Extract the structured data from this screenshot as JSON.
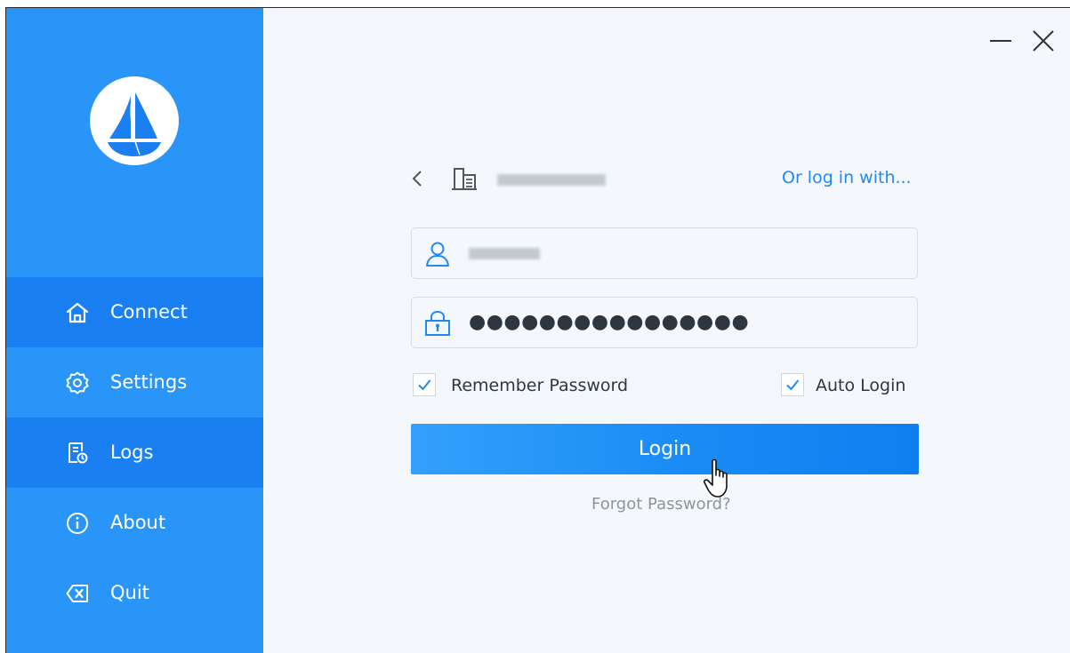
{
  "window": {
    "minimize_icon": "minimize-icon",
    "close_icon": "close-icon"
  },
  "sidebar": {
    "logo_icon": "sailboat-logo",
    "items": [
      {
        "label": "Connect",
        "icon": "home-icon",
        "active": true
      },
      {
        "label": "Settings",
        "icon": "gear-icon",
        "active": false
      },
      {
        "label": "Logs",
        "icon": "log-document-icon",
        "active": true
      },
      {
        "label": "About",
        "icon": "info-icon",
        "active": false
      },
      {
        "label": "Quit",
        "icon": "backspace-icon",
        "active": false
      }
    ]
  },
  "login": {
    "back_icon": "chevron-left-icon",
    "org_icon": "building-icon",
    "alt_login_link": "Or log in with...",
    "username_icon": "user-icon",
    "password_icon": "lock-icon",
    "password_masked": "●●●●●●●●●●●●●●●●",
    "remember_password_label": "Remember Password",
    "remember_password_checked": true,
    "auto_login_label": "Auto Login",
    "auto_login_checked": true,
    "login_button_label": "Login",
    "forgot_password_link": "Forgot Password?"
  },
  "colors": {
    "sidebar": "#2a95f8",
    "sidebar_active": "#1a7ff0",
    "accent": "#2189f2",
    "background": "#f4f8fc"
  }
}
